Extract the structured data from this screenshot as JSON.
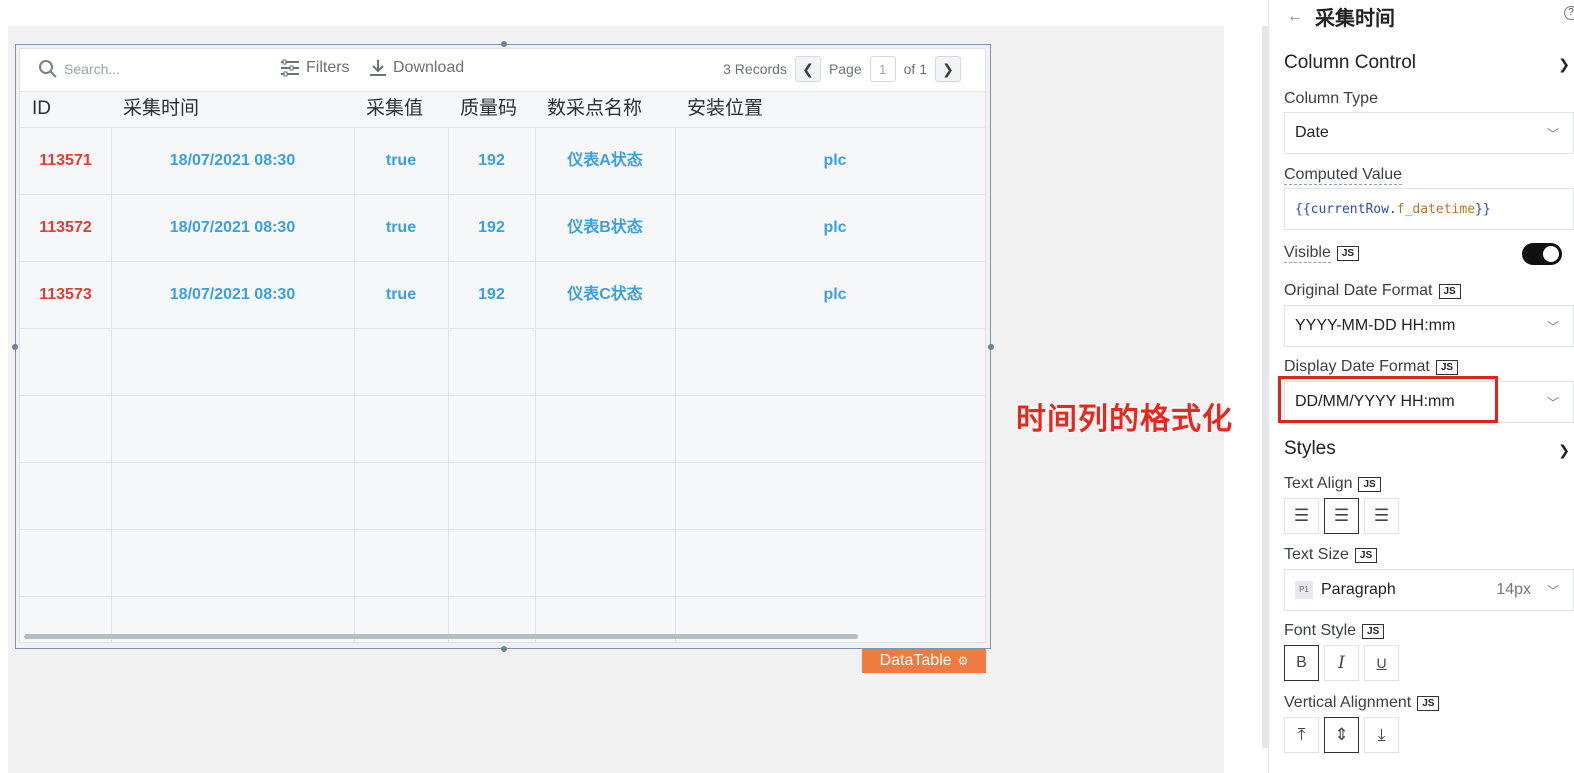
{
  "table": {
    "search_placeholder": "Search...",
    "filters_label": "Filters",
    "download_label": "Download",
    "records_label": "3 Records",
    "page_label": "Page",
    "page_value": "1",
    "of_label": "of 1",
    "columns": [
      "ID",
      "采集时间",
      "采集值",
      "质量码",
      "数采点名称",
      "安装位置"
    ],
    "rows": [
      {
        "id": "113571",
        "time": "18/07/2021 08:30",
        "value": "true",
        "quality": "192",
        "name": "仪表A状态",
        "location": "plc"
      },
      {
        "id": "113572",
        "time": "18/07/2021 08:30",
        "value": "true",
        "quality": "192",
        "name": "仪表B状态",
        "location": "plc"
      },
      {
        "id": "113573",
        "time": "18/07/2021 08:30",
        "value": "true",
        "quality": "192",
        "name": "仪表C状态",
        "location": "plc"
      }
    ],
    "widget_badge": "DataTable"
  },
  "annotation_text": "时间列的格式化",
  "panel": {
    "title": "采集时间",
    "column_control": "Column Control",
    "column_type_label": "Column Type",
    "column_type_value": "Date",
    "computed_value_label": "Computed Value",
    "computed_value_open": "{{currentRow.",
    "computed_value_prop": "f_datetime",
    "computed_value_close": "}}",
    "visible_label": "Visible",
    "visible_on": true,
    "original_format_label": "Original Date Format",
    "original_format_value": "YYYY-MM-DD HH:mm",
    "display_format_label": "Display Date Format",
    "display_format_value": "DD/MM/YYYY HH:mm",
    "styles_label": "Styles",
    "text_align_label": "Text Align",
    "text_size_label": "Text Size",
    "text_size_badge": "P1",
    "text_size_value": "Paragraph",
    "text_size_px": "14px",
    "font_style_label": "Font Style",
    "font_style_buttons": [
      "B",
      "I",
      "U"
    ],
    "vertical_alignment_label": "Vertical Alignment",
    "js_badge": "JS",
    "help_icon": "?"
  },
  "colors": {
    "id_text": "#e03c32",
    "cell_text": "#3aa0e0",
    "badge": "#f07b42",
    "annotation": "#e8281e"
  }
}
